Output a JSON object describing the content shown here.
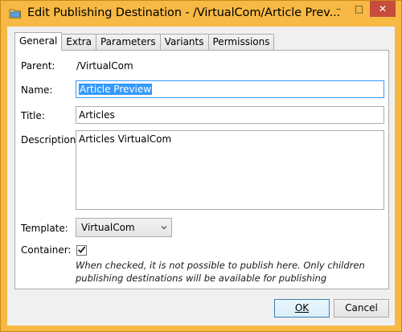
{
  "window": {
    "title": "Edit Publishing Destination - /VirtualCom/Article Prev...",
    "minimize_glyph": "–",
    "maximize_glyph": "□",
    "close_glyph": "✕"
  },
  "tabs": [
    {
      "label": "General",
      "active": true
    },
    {
      "label": "Extra"
    },
    {
      "label": "Parameters"
    },
    {
      "label": "Variants"
    },
    {
      "label": "Permissions"
    }
  ],
  "form": {
    "parent_label": "Parent:",
    "parent_value": "/VirtualCom",
    "name_label": "Name:",
    "name_value": "Article Preview",
    "title_label": "Title:",
    "title_value": "Articles",
    "description_label": "Description:",
    "description_value": "Articles VirtualCom",
    "template_label": "Template:",
    "template_value": "VirtualCom",
    "container_label": "Container:",
    "container_checked": true,
    "container_hint": "When checked, it is not possible to publish here. Only children publishing destinations will be available for publishing"
  },
  "buttons": {
    "ok_label": "OK",
    "cancel_label": "Cancel"
  },
  "icons": [
    "folder-icon",
    "minimize-icon",
    "maximize-icon",
    "close-icon",
    "chevron-down-icon",
    "checkmark-icon"
  ],
  "colors": {
    "frame": "#f7b944",
    "selection": "#3399ff",
    "close_button": "#c74c3c"
  }
}
